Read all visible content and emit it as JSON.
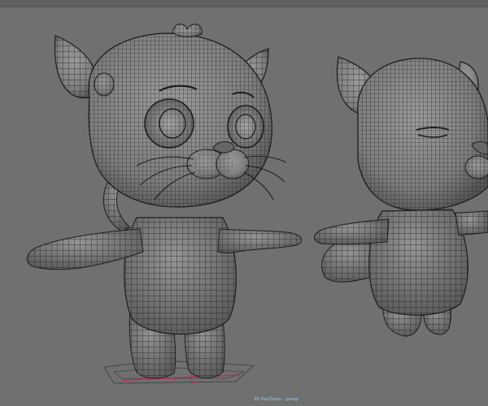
{
  "viewport": {
    "camera_label": "3D PanZoom : persp"
  },
  "colors": {
    "background": "#707070",
    "mesh_fill": "#8a8a8a",
    "mesh_shadow": "#5c5c5c",
    "wire": "#1e1e1e",
    "grid_red": "#d11d55",
    "label": "#8fd3ff"
  }
}
